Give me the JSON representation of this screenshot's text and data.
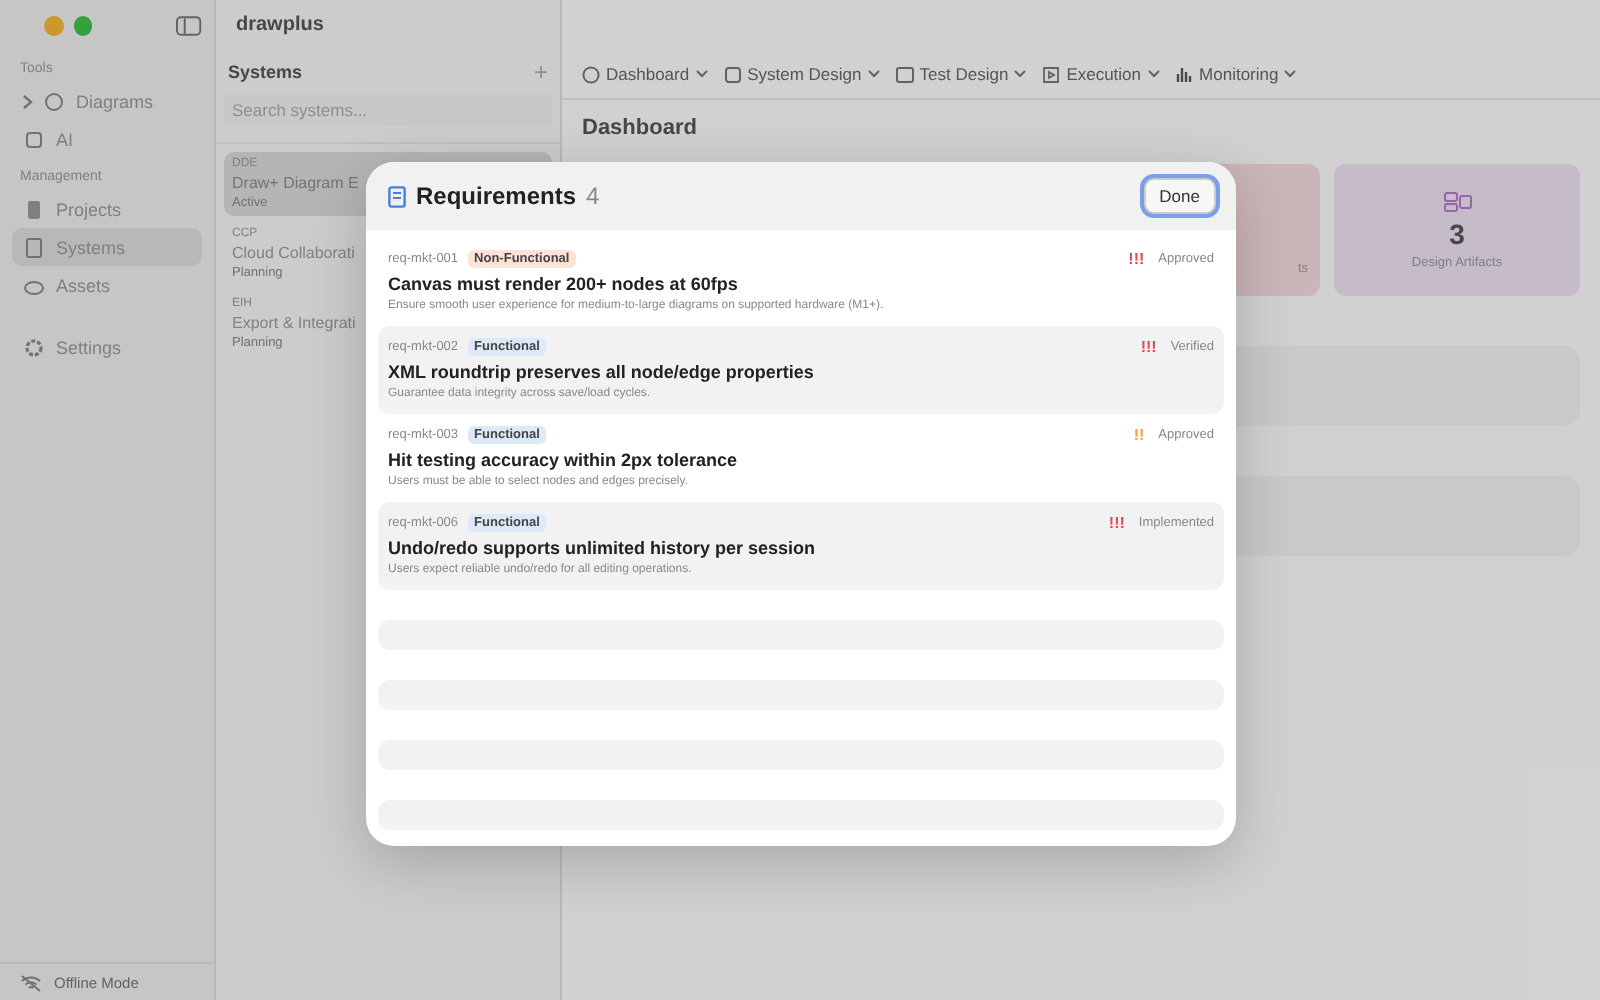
{
  "window": {
    "title": "drawplus"
  },
  "sidebar": {
    "sections": [
      {
        "title": "Tools",
        "items": [
          {
            "label": "Diagrams",
            "expanded": false,
            "selected": false
          },
          {
            "label": "AI",
            "selected": false
          }
        ]
      },
      {
        "title": "Management",
        "items": [
          {
            "label": "Projects",
            "selected": false
          },
          {
            "label": "Systems",
            "selected": true
          },
          {
            "label": "Assets",
            "selected": false
          }
        ]
      },
      {
        "items": [
          {
            "label": "Settings",
            "selected": false
          }
        ]
      }
    ],
    "status": "Offline Mode"
  },
  "systems": {
    "title": "Systems",
    "add": "+",
    "search": {
      "placeholder": "Search systems..."
    },
    "items": [
      {
        "code": "DDE",
        "name": "Draw+ Diagram E",
        "status": "Active",
        "selected": true
      },
      {
        "code": "CCP",
        "name": "Cloud Collaborati",
        "status": "Planning",
        "selected": false
      },
      {
        "code": "EIH",
        "name": "Export & Integrati",
        "status": "Planning",
        "selected": false
      }
    ]
  },
  "toolbar": [
    {
      "label": "Dashboard"
    },
    {
      "label": "System Design"
    },
    {
      "label": "Test Design"
    },
    {
      "label": "Execution"
    },
    {
      "label": "Monitoring"
    }
  ],
  "page_title": "Dashboard",
  "metrics": [
    {
      "label": "ts"
    },
    {
      "value": "3",
      "label": "Design Artifacts"
    }
  ],
  "dialog": {
    "title": "Requirements",
    "count": "4",
    "done": "Done",
    "rows": [
      {
        "id": "req-mkt-001",
        "tag": {
          "text": "Non-Functional",
          "color": "#fde3d6"
        },
        "priority": {
          "text": "!!!",
          "color": "#e5484d"
        },
        "status": "Approved",
        "title": "Canvas must render 200+ nodes at 60fps",
        "description": "Ensure smooth user experience for medium-to-large diagrams on supported hardware (M1+)."
      },
      {
        "id": "req-mkt-002",
        "tag": {
          "text": "Functional",
          "color": "#dde8f8"
        },
        "priority": {
          "text": "!!!",
          "color": "#e5484d"
        },
        "status": "Verified",
        "title": "XML roundtrip preserves all node/edge properties",
        "description": "Guarantee data integrity across save/load cycles."
      },
      {
        "id": "req-mkt-003",
        "tag": {
          "text": "Functional",
          "color": "#dde8f8"
        },
        "priority": {
          "text": "!!",
          "color": "#f0a040"
        },
        "status": "Approved",
        "title": "Hit testing accuracy within 2px tolerance",
        "description": "Users must be able to select nodes and edges precisely."
      },
      {
        "id": "req-mkt-006",
        "tag": {
          "text": "Functional",
          "color": "#dde8f8"
        },
        "priority": {
          "text": "!!!",
          "color": "#e5484d"
        },
        "status": "Implemented",
        "title": "Undo/redo supports unlimited history per session",
        "description": "Users expect reliable undo/redo for all editing operations."
      }
    ]
  }
}
